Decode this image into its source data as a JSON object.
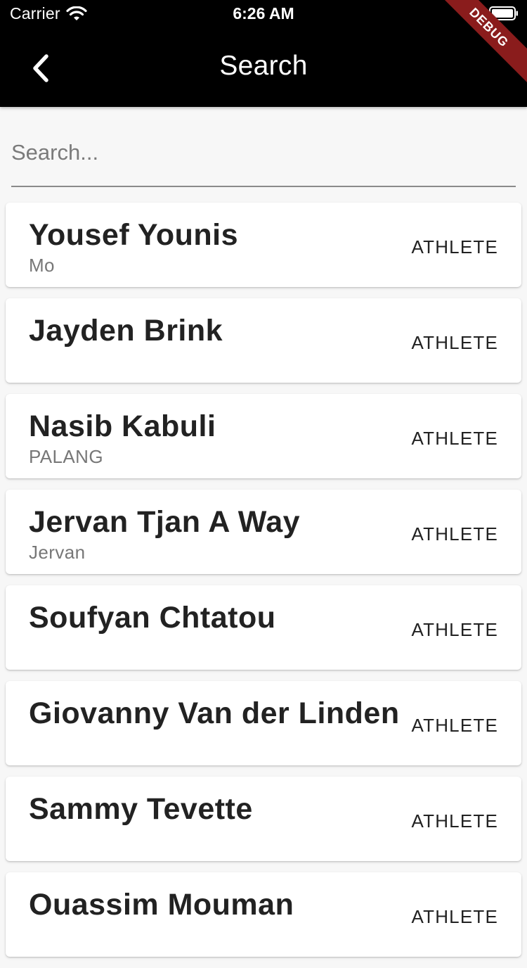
{
  "status_bar": {
    "carrier": "Carrier",
    "time": "6:26 AM"
  },
  "app_bar": {
    "title": "Search",
    "debug_label": "DEBUG",
    "background": "#000000",
    "banner_color": "#8a1c1c"
  },
  "search": {
    "placeholder": "Search...",
    "value": ""
  },
  "results": [
    {
      "name": "Yousef Younis",
      "nickname": "Mo",
      "role": "ATHLETE"
    },
    {
      "name": "Jayden Brink",
      "nickname": "",
      "role": "ATHLETE"
    },
    {
      "name": "Nasib Kabuli",
      "nickname": "PALANG",
      "role": "ATHLETE"
    },
    {
      "name": "Jervan Tjan A Way",
      "nickname": "Jervan",
      "role": "ATHLETE"
    },
    {
      "name": "Soufyan Chtatou",
      "nickname": "",
      "role": "ATHLETE"
    },
    {
      "name": "Giovanny Van der Linden",
      "nickname": "",
      "role": "ATHLETE"
    },
    {
      "name": "Sammy Tevette",
      "nickname": "",
      "role": "ATHLETE"
    },
    {
      "name": "Ouassim Mouman",
      "nickname": "",
      "role": "ATHLETE"
    }
  ],
  "icons": {
    "back": "chevron-left-icon",
    "wifi": "wifi-icon",
    "battery": "battery-icon"
  }
}
